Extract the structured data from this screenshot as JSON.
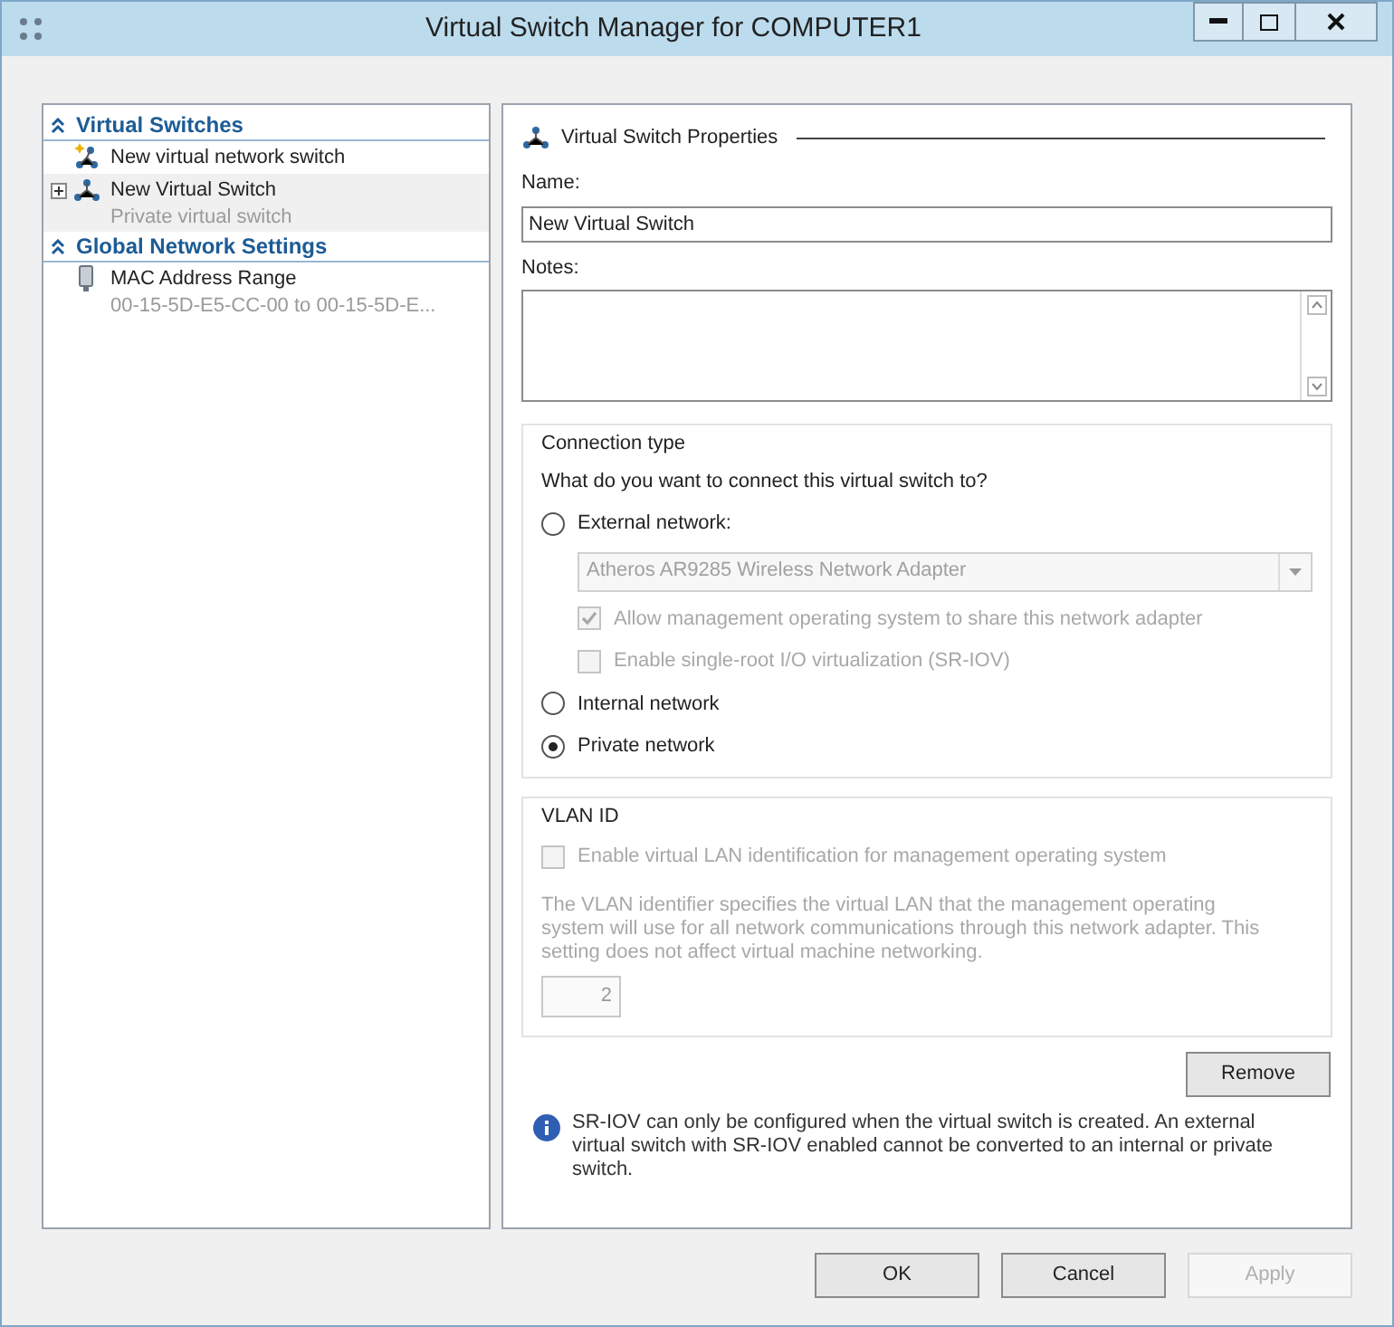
{
  "window": {
    "title": "Virtual Switch Manager for COMPUTER1"
  },
  "sidebar": {
    "sections": [
      {
        "title": "Virtual Switches",
        "expanded": true,
        "items": [
          {
            "kind": "new",
            "label": "New virtual network switch",
            "selected": false
          },
          {
            "kind": "switch",
            "label": "New Virtual Switch",
            "subtitle": "Private virtual switch",
            "selected": true,
            "expanded": false
          }
        ]
      },
      {
        "title": "Global Network Settings",
        "expanded": true,
        "items": [
          {
            "kind": "mac",
            "label": "MAC Address Range",
            "subtitle": "00-15-5D-E5-CC-00 to 00-15-5D-E...",
            "selected": false
          }
        ]
      }
    ]
  },
  "properties": {
    "heading": "Virtual Switch Properties",
    "name_label": "Name:",
    "name_value": "New Virtual Switch",
    "notes_label": "Notes:",
    "connection": {
      "title": "Connection type",
      "question": "What do you want to connect this virtual switch to?",
      "options": [
        {
          "label": "External network:",
          "selected": false
        },
        {
          "label": "Internal network",
          "selected": false
        },
        {
          "label": "Private network",
          "selected": true
        }
      ],
      "adapter": {
        "value": "Atheros AR9285 Wireless Network Adapter",
        "disabled": true
      },
      "checkboxes": [
        {
          "label": "Allow management operating system to share this network adapter",
          "checked": true,
          "disabled": true
        },
        {
          "label": "Enable single-root I/O virtualization (SR-IOV)",
          "checked": false,
          "disabled": true
        }
      ]
    },
    "vlan": {
      "title": "VLAN ID",
      "checkbox": {
        "label": "Enable virtual LAN identification for management operating system",
        "checked": false,
        "disabled": true
      },
      "description": "The VLAN identifier specifies the virtual LAN that the management operating system will use for all network communications through this network adapter. This setting does not affect virtual machine networking.",
      "value": "2",
      "disabled": true
    },
    "remove_button": "Remove",
    "info": "SR-IOV can only be configured when the virtual switch is created. An external virtual switch with SR-IOV enabled cannot be converted to an internal or private switch."
  },
  "buttons": [
    {
      "label": "OK",
      "disabled": false
    },
    {
      "label": "Cancel",
      "disabled": false
    },
    {
      "label": "Apply",
      "disabled": true
    }
  ]
}
